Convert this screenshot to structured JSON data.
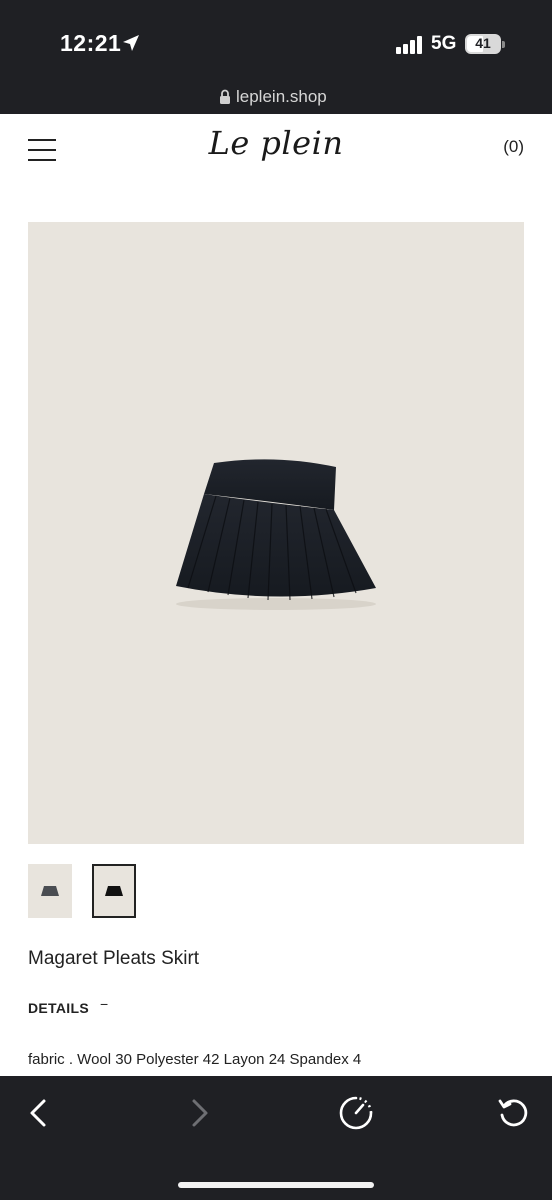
{
  "status_bar": {
    "time": "12:21",
    "network": "5G",
    "battery": "41",
    "signal_bars": 4
  },
  "url_bar": {
    "domain": "leplein.shop"
  },
  "site": {
    "logo": "Le plein",
    "cart": "(0)"
  },
  "product": {
    "name": "Magaret Pleats Skirt",
    "details_label": "DETAILS",
    "details_toggle": "−",
    "fabric": "fabric . Wool 30 Polyester 42 Layon 24 Spandex 4",
    "thumbnails": [
      {
        "name": "thumb-gray",
        "selected": false
      },
      {
        "name": "thumb-black",
        "selected": true
      }
    ]
  },
  "colors": {
    "chrome": "#1f2024",
    "image_bg": "#e8e4dd",
    "skirt": "#1d2129"
  },
  "icons": [
    "location-arrow-icon",
    "signal-icon",
    "battery-icon",
    "lock-icon",
    "menu-icon",
    "back-icon",
    "forward-icon",
    "speedometer-icon",
    "reload-icon"
  ]
}
